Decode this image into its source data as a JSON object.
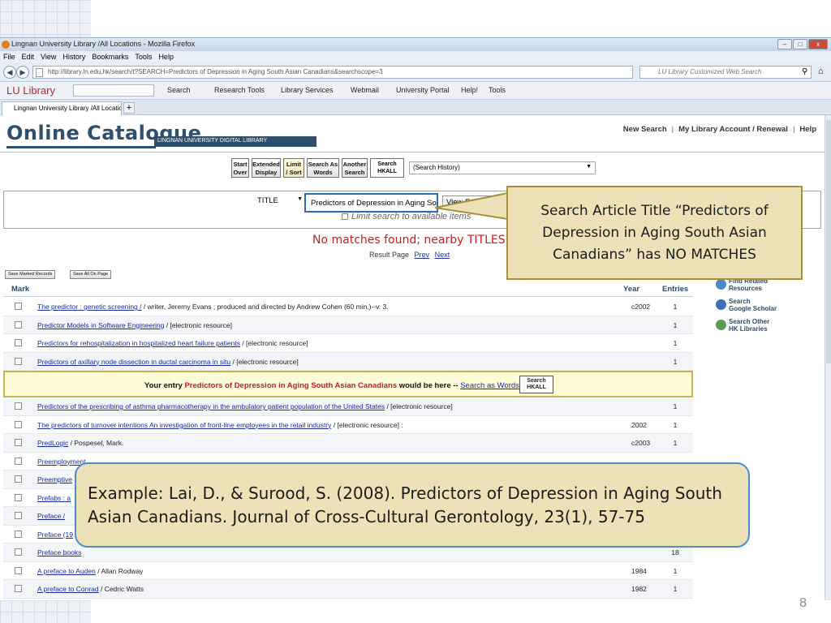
{
  "browser": {
    "window_title": "Lingnan University Library /All Locations - Mozilla Firefox",
    "menu": [
      "File",
      "Edit",
      "View",
      "History",
      "Bookmarks",
      "Tools",
      "Help"
    ],
    "url": "http://library.ln.edu.hk/search/t?SEARCH=Predictors of Depression in Aging South Asian Canadians&searchscope=3",
    "search_placeholder": "LU Library Customized Web Search",
    "toolbar": {
      "brand": "LU Library",
      "items": [
        "Search",
        "Research Tools",
        "Library Services",
        "Webmail",
        "University Portal",
        "Help!",
        "Tools"
      ]
    },
    "tab_title": "Lingnan University Library /All Locations",
    "new_tab": "+"
  },
  "catalogue": {
    "logo": "Online Catalogue",
    "logo_sub": "LINGNAN UNIVERSITY DIGITAL LIBRARY",
    "top_links": [
      "New Search",
      "My Library Account / Renewal",
      "Help"
    ],
    "buttons": [
      {
        "line1": "Start",
        "line2": "Over"
      },
      {
        "line1": "Extended",
        "line2": "Display"
      },
      {
        "line1": "Limit",
        "line2": "/ Sort"
      },
      {
        "line1": "Search As",
        "line2": "Words"
      },
      {
        "line1": "Another",
        "line2": "Search"
      }
    ],
    "hkall_line1": "Search",
    "hkall_line2": "HKALL",
    "history_select": "(Search History)",
    "search_type": "TITLE",
    "search_value": "Predictors of Depression in Aging So",
    "view_entire": "View Entire Collection",
    "limit_search": "Limit search to available items",
    "no_matches": "No matches found; nearby TITLES are:",
    "result_page_label": "Result Page",
    "prev": "Prev",
    "next": "Next",
    "save_marked": "Save Marked Records",
    "save_all": "Save All On Page",
    "col_mark": "Mark",
    "col_year": "Year",
    "col_entries": "Entries",
    "rows_before": [
      {
        "title": "The predictor : genetic screening /",
        "rest": " / writer, Jeremy Evans ; produced and directed by Andrew Cohen (60 min.)--v. 3.",
        "year": "c2002",
        "entries": "1"
      },
      {
        "title": "Predictor Models in Software Engineering",
        "rest": " / [electronic resource]",
        "year": "",
        "entries": "1"
      },
      {
        "title": "Predictors for rehospitalization in hospitalized heart failure patients",
        "rest": " / [electronic resource]",
        "year": "",
        "entries": "1"
      },
      {
        "title": "Predictors of axillary node dissection in ductal carcinoma in situ",
        "rest": " / [electronic resource]",
        "year": "",
        "entries": "1"
      }
    ],
    "highlight": {
      "prefix": "Your entry ",
      "entry": "Predictors of Depression in Aging South Asian Canadians",
      "suffix": " would be here -- ",
      "link": "Search as Words",
      "tail": " --"
    },
    "rows_after": [
      {
        "title": "Predictors of the prescribing of asthma pharmacotherapy in the ambulatory patient population of the United States",
        "rest": " / [electronic resource]",
        "year": "",
        "entries": "1"
      },
      {
        "title": "The predictors of turnover intentions An investigation of front-line employees in the retail industry",
        "rest": " / [electronic resource] :",
        "year": "2002",
        "entries": "1"
      },
      {
        "title": "PredLogic",
        "rest": " / Pospesel, Mark.",
        "year": "c2003",
        "entries": "1"
      },
      {
        "title": "Preemployment",
        "rest": "",
        "year": "",
        "entries": ""
      },
      {
        "title": "Preemptive",
        "rest": "",
        "year": "",
        "entries": ""
      },
      {
        "title": "Prefabs : a",
        "rest": "",
        "year": "",
        "entries": ""
      },
      {
        "title": "Preface /",
        "rest": "",
        "year": "",
        "entries": ""
      },
      {
        "title": "Preface (19",
        "rest": "",
        "year": "",
        "entries": ""
      },
      {
        "title": "Preface books",
        "rest": "",
        "year": "",
        "entries": "18"
      },
      {
        "title": "A preface to Auden",
        "rest": " / Allan Rodway",
        "year": "1984",
        "entries": "1"
      },
      {
        "title": "A preface to Conrad",
        "rest": " / Cedric Watts",
        "year": "1982",
        "entries": "1"
      }
    ],
    "side": [
      {
        "icon": "find-related-icon",
        "line1": "Find Related",
        "line2": "Resources"
      },
      {
        "icon": "google-scholar-icon",
        "line1": "Search",
        "line2": "Google Scholar"
      },
      {
        "icon": "hk-libraries-icon",
        "line1": "Search Other",
        "line2": "HK Libraries"
      }
    ]
  },
  "callouts": {
    "top": "Search Article Title “Predictors of Depression in Aging South Asian Canadians” has NO MATCHES",
    "bottom": "Example: Lai, D., & Surood, S. (2008). Predictors of Depression in Aging South Asian Canadians. Journal of Cross-Cultural Gerontology, 23(1), 57-75"
  },
  "slide": {
    "page_number": "8"
  },
  "colors": {
    "accent": "#2e4f6e",
    "error": "#c42020",
    "callout_fill": "#ede2b7",
    "callout_border": "#a68f3c"
  }
}
